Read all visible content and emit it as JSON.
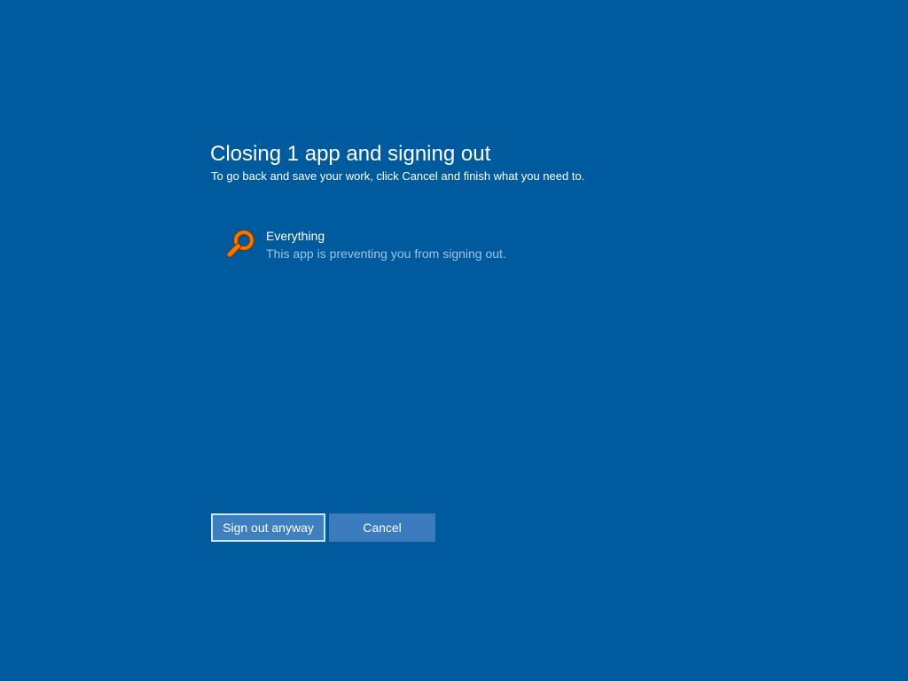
{
  "dialog": {
    "title": "Closing 1 app and signing out",
    "subtitle": "To go back and save your work, click Cancel and finish what you need to."
  },
  "apps": [
    {
      "name": "Everything",
      "status": "This app is preventing you from signing out.",
      "icon": "magnifier-icon"
    }
  ],
  "buttons": {
    "sign_out_label": "Sign out anyway",
    "cancel_label": "Cancel"
  },
  "colors": {
    "background": "#005a9e",
    "button": "#3d7fbf",
    "secondary_text": "#9ec3e6",
    "app_icon": "#f07800"
  }
}
